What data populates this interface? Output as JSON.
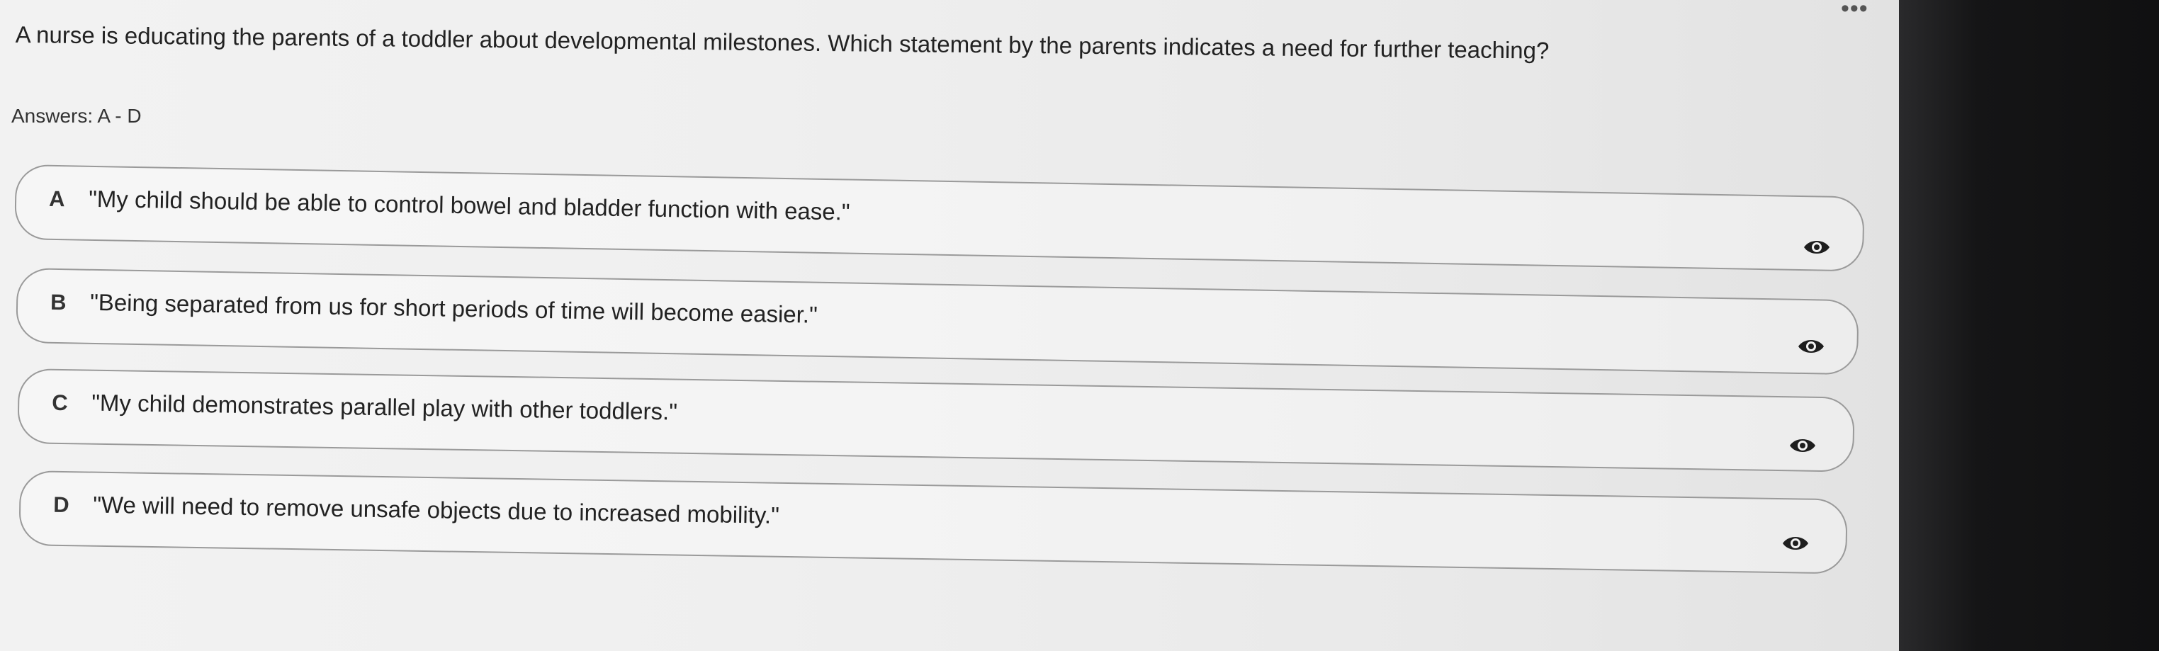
{
  "question": {
    "text": "A nurse is educating the parents of a toddler about developmental milestones. Which statement by the parents indicates a need for further teaching?"
  },
  "answers_label": "Answers: A - D",
  "menu": {
    "more_icon": "more-horizontal-icon",
    "more_glyph": "•••"
  },
  "options": [
    {
      "letter": "A",
      "text": "\"My child should be able to control bowel and bladder function with ease.\"",
      "icon": "eye-icon"
    },
    {
      "letter": "B",
      "text": "\"Being separated from us for short periods of time will become easier.\"",
      "icon": "eye-icon"
    },
    {
      "letter": "C",
      "text": "\"My child demonstrates parallel play with other toddlers.\"",
      "icon": "eye-icon"
    },
    {
      "letter": "D",
      "text": "\"We will need to remove unsafe objects due to increased mobility.\"",
      "icon": "eye-icon"
    }
  ],
  "colors": {
    "background": "#efefef",
    "border": "#9a9a9a",
    "text": "#222222",
    "bezel": "#151516"
  }
}
